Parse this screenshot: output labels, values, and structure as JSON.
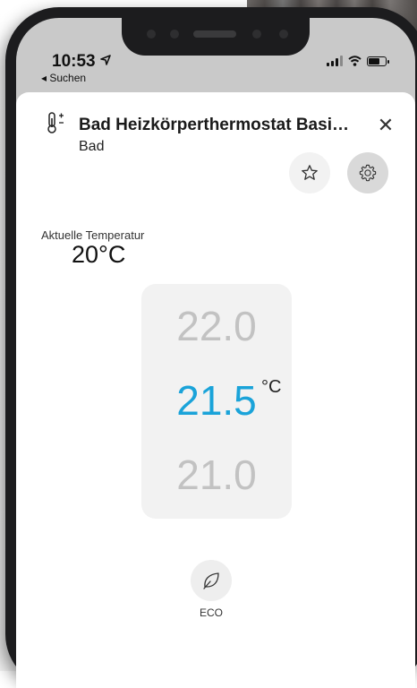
{
  "status": {
    "time": "10:53",
    "back_label": "◂ Suchen"
  },
  "header": {
    "title": "Bad Heizkörperthermostat Basi…",
    "subtitle": "Bad",
    "close_symbol": "✕",
    "favorite_icon": "star-icon",
    "settings_icon": "gear-icon",
    "device_icon": "thermometer-icon"
  },
  "current_temperature": {
    "label": "Aktuelle Temperatur",
    "value": "20°C"
  },
  "setpoint_picker": {
    "above": "22.0",
    "selected": "21.5",
    "below": "21.0",
    "unit": "°C",
    "selected_color": "#1aa3d9"
  },
  "eco": {
    "label": "ECO",
    "icon": "leaf-icon"
  }
}
